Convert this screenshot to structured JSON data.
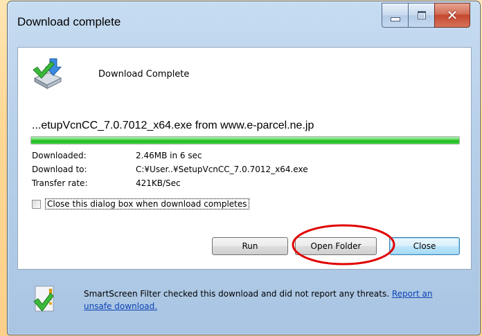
{
  "window": {
    "title": "Download complete"
  },
  "header": {
    "title": "Download Complete",
    "icon": "download-complete-icon"
  },
  "file": {
    "name_from": "...etupVcnCC_7.0.7012_x64.exe from www.e-parcel.ne.jp",
    "progress_percent": 100
  },
  "details": [
    {
      "label": "Downloaded:",
      "value": "2.46MB in 6 sec"
    },
    {
      "label": "Download to:",
      "value": "C:¥User..¥SetupVcnCC_7.0.7012_x64.exe"
    },
    {
      "label": "Transfer rate:",
      "value": "421KB/Sec"
    }
  ],
  "options": {
    "close_when_complete_label": "Close this dialog box when download completes",
    "close_when_complete_checked": false
  },
  "buttons": {
    "run": "Run",
    "open_folder": "Open Folder",
    "close": "Close"
  },
  "footer": {
    "message": "SmartScreen Filter checked this download and did not report any threats.",
    "link": "Report an unsafe download.",
    "icon": "smartscreen-shield-icon"
  },
  "colors": {
    "progress": "#22b822",
    "highlight": "#e00000",
    "link": "#0b43b5"
  }
}
